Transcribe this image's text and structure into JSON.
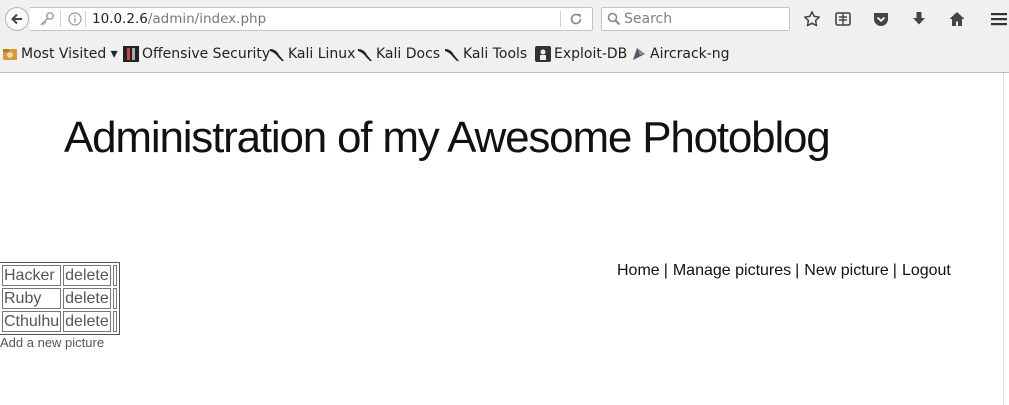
{
  "browser": {
    "url_host": "10.0.2.6",
    "url_path": "/admin/index.php",
    "search_placeholder": "Search",
    "bookmarks": [
      {
        "label": "Most Visited ▾",
        "icon": "most-visited-icon"
      },
      {
        "label": "Offensive Security",
        "icon": "offsec-icon"
      },
      {
        "label": "Kali Linux",
        "icon": "kali-dragon-icon"
      },
      {
        "label": "Kali Docs",
        "icon": "kali-dragon-icon"
      },
      {
        "label": "Kali Tools",
        "icon": "kali-dragon-icon"
      },
      {
        "label": "Exploit-DB",
        "icon": "exploitdb-icon"
      },
      {
        "label": "Aircrack-ng",
        "icon": "aircrack-icon"
      }
    ]
  },
  "page": {
    "title": "Administration of my Awesome Photoblog",
    "menu": [
      {
        "label": "Home"
      },
      {
        "label": "Manage pictures"
      },
      {
        "label": "New picture"
      },
      {
        "label": "Logout"
      }
    ],
    "pictures": [
      {
        "name": "Hacker",
        "action": "delete"
      },
      {
        "name": "Ruby",
        "action": "delete"
      },
      {
        "name": "Cthulhu",
        "action": "delete"
      }
    ],
    "add_link": "Add a new picture"
  }
}
